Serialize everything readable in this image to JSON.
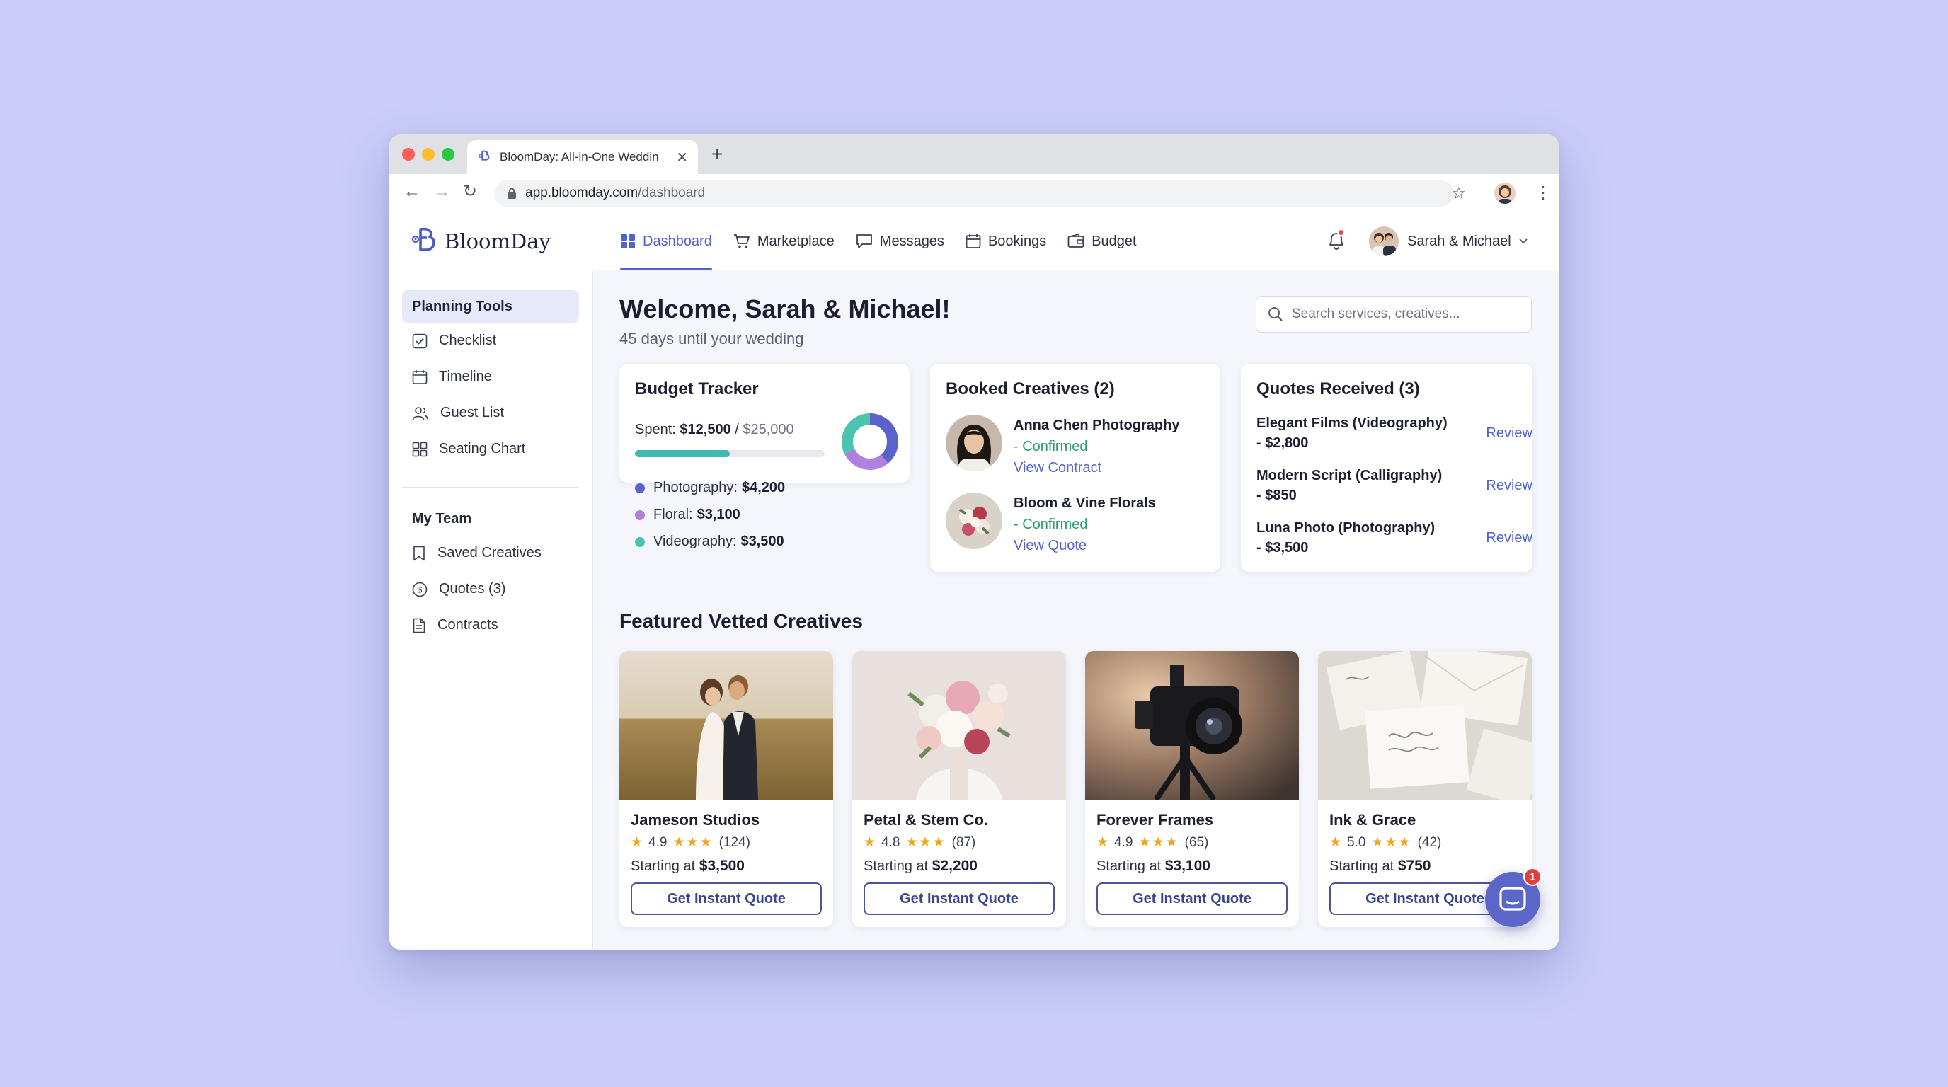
{
  "browser": {
    "tab_title": "BloomDay: All-in-One Weddin",
    "url_host": "app.bloomday.com",
    "url_path": "/dashboard"
  },
  "app": {
    "name": "BloomDay",
    "brand_color": "#5062cf"
  },
  "nav": {
    "items": [
      {
        "label": "Dashboard",
        "icon": "grid-icon",
        "active": true
      },
      {
        "label": "Marketplace",
        "icon": "cart-icon"
      },
      {
        "label": "Messages",
        "icon": "chat-icon"
      },
      {
        "label": "Bookings",
        "icon": "calendar-icon"
      },
      {
        "label": "Budget",
        "icon": "wallet-icon"
      }
    ]
  },
  "user": {
    "name": "Sarah & Michael",
    "notification_dot": true
  },
  "sidebar": {
    "planning_title": "Planning Tools",
    "planning_items": [
      {
        "label": "Checklist",
        "icon": "checkbox-icon"
      },
      {
        "label": "Timeline",
        "icon": "calendar-icon"
      },
      {
        "label": "Guest List",
        "icon": "users-icon"
      },
      {
        "label": "Seating Chart",
        "icon": "grid-icon"
      }
    ],
    "team_title": "My Team",
    "team_items": [
      {
        "label": "Saved Creatives",
        "icon": "bookmark-icon"
      },
      {
        "label": "Quotes (3)",
        "icon": "dollar-icon"
      },
      {
        "label": "Contracts",
        "icon": "document-icon"
      }
    ]
  },
  "main": {
    "welcome": "Welcome, Sarah & Michael!",
    "countdown": "45 days until your wedding",
    "search_placeholder": "Search services, creatives..."
  },
  "budget": {
    "title": "Budget Tracker",
    "spent_label": "Spent:",
    "spent": "$12,500",
    "total": "$25,000",
    "spent_fraction": 0.5,
    "categories": [
      {
        "label": "Photography:",
        "amount": "$4,200",
        "value": 4200,
        "color": "#5b62c9"
      },
      {
        "label": "Floral:",
        "amount": "$3,100",
        "value": 3100,
        "color": "#b07fe0"
      },
      {
        "label": "Videography:",
        "amount": "$3,500",
        "value": 3500,
        "color": "#4cc3b0"
      }
    ]
  },
  "booked": {
    "title": "Booked Creatives (2)",
    "items": [
      {
        "name": "Anna Chen Photography",
        "status": "- Confirmed",
        "link": "View Contract"
      },
      {
        "name": "Bloom & Vine Florals",
        "status": "- Confirmed",
        "link": "View Quote"
      }
    ]
  },
  "quotes": {
    "title": "Quotes Received (3)",
    "items": [
      {
        "line1": "Elegant Films (Videography)",
        "line2": "- $2,800",
        "action": "Review"
      },
      {
        "line1": "Modern Script (Calligraphy)",
        "line2": "- $850",
        "action": "Review"
      },
      {
        "line1": "Luna Photo (Photography)",
        "line2": "- $3,500",
        "action": "Review"
      }
    ]
  },
  "featured": {
    "title": "Featured Vetted Creatives",
    "starting_label": "Starting at",
    "button_label": "Get Instant Quote",
    "stars": "★★★",
    "items": [
      {
        "name": "Jameson Studios",
        "rating": "4.9",
        "reviews": "(124)",
        "price": "$3,500"
      },
      {
        "name": "Petal & Stem Co.",
        "rating": "4.8",
        "reviews": "(87)",
        "price": "$2,200"
      },
      {
        "name": "Forever Frames",
        "rating": "4.9",
        "reviews": "(65)",
        "price": "$3,100"
      },
      {
        "name": "Ink & Grace",
        "rating": "5.0",
        "reviews": "(42)",
        "price": "$750"
      }
    ]
  },
  "chat": {
    "badge": "1"
  }
}
